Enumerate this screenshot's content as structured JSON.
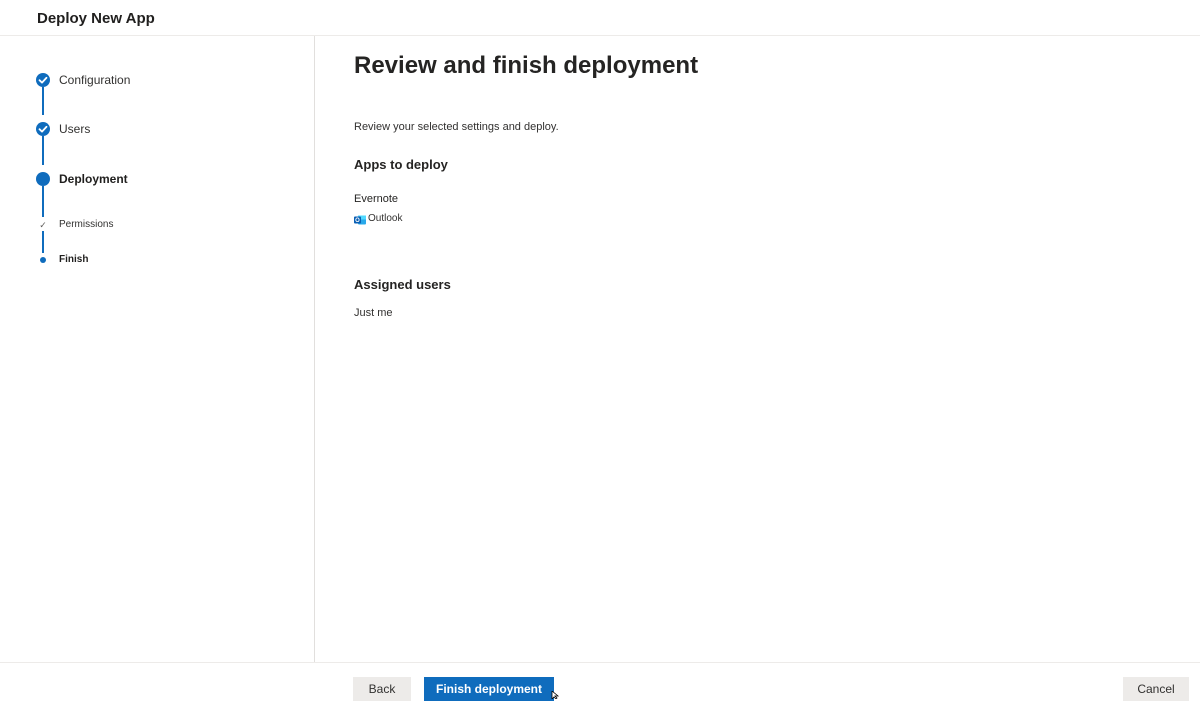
{
  "header": {
    "title": "Deploy New App"
  },
  "stepper": {
    "steps": [
      {
        "label": "Configuration",
        "state": "completed"
      },
      {
        "label": "Users",
        "state": "completed"
      },
      {
        "label": "Deployment",
        "state": "current"
      }
    ],
    "substeps": [
      {
        "label": "Permissions",
        "state": "completed"
      },
      {
        "label": "Finish",
        "state": "current"
      }
    ]
  },
  "main": {
    "title": "Review and finish deployment",
    "intro": "Review your selected settings and deploy.",
    "apps_heading": "Apps to deploy",
    "app": {
      "name": "Evernote",
      "platform": "Outlook",
      "platform_icon": "outlook-icon"
    },
    "users_heading": "Assigned users",
    "users_value": "Just me"
  },
  "footer": {
    "back_label": "Back",
    "finish_label": "Finish deployment",
    "cancel_label": "Cancel"
  },
  "colors": {
    "accent": "#0f6cbd",
    "secondary_button": "#edebe9",
    "text": "#323130"
  }
}
